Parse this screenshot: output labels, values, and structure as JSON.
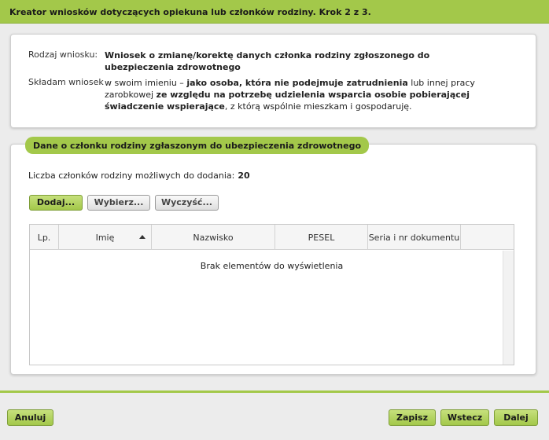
{
  "header": {
    "title": "Kreator wniosków dotyczących opiekuna lub członków rodziny. Krok 2 z 3."
  },
  "summary": {
    "kind_label": "Rodzaj wniosku:",
    "kind_value": "Wniosek o zmianę/korektę danych członka rodziny zgłoszonego do ubezpieczenia zdrowotnego",
    "declare_label": "Składam wniosek",
    "declare_parts": [
      "w swoim imieniu – ",
      "jako osoba, która nie podejmuje zatrudnienia",
      " lub innej pracy zarobkowej ",
      "ze względu na potrzebę udzielenia wsparcia osobie pobierającej świadczenie wspierające",
      ", z którą wspólnie mieszkam i gospodaruję."
    ]
  },
  "section": {
    "title": "Dane o członku rodziny zgłaszonym do ubezpieczenia zdrowotnego",
    "count_label": "Liczba członków rodziny możliwych do dodania:",
    "count_value": "20",
    "buttons": {
      "add": "Dodaj...",
      "choose": "Wybierz...",
      "clear": "Wyczyść..."
    },
    "table": {
      "columns": [
        "Lp.",
        "Imię",
        "Nazwisko",
        "PESEL",
        "Seria i nr dokumentu",
        ""
      ],
      "sort_column": "Imię",
      "sort_direction": "ascending",
      "empty_message": "Brak elementów do wyświetlenia",
      "rows": []
    }
  },
  "footer": {
    "cancel": "Anuluj",
    "save": "Zapisz",
    "back": "Wstecz",
    "next": "Dalej"
  },
  "colors": {
    "accent": "#a3c84a",
    "accent_dark": "#7e9e38",
    "background": "#ececec"
  }
}
